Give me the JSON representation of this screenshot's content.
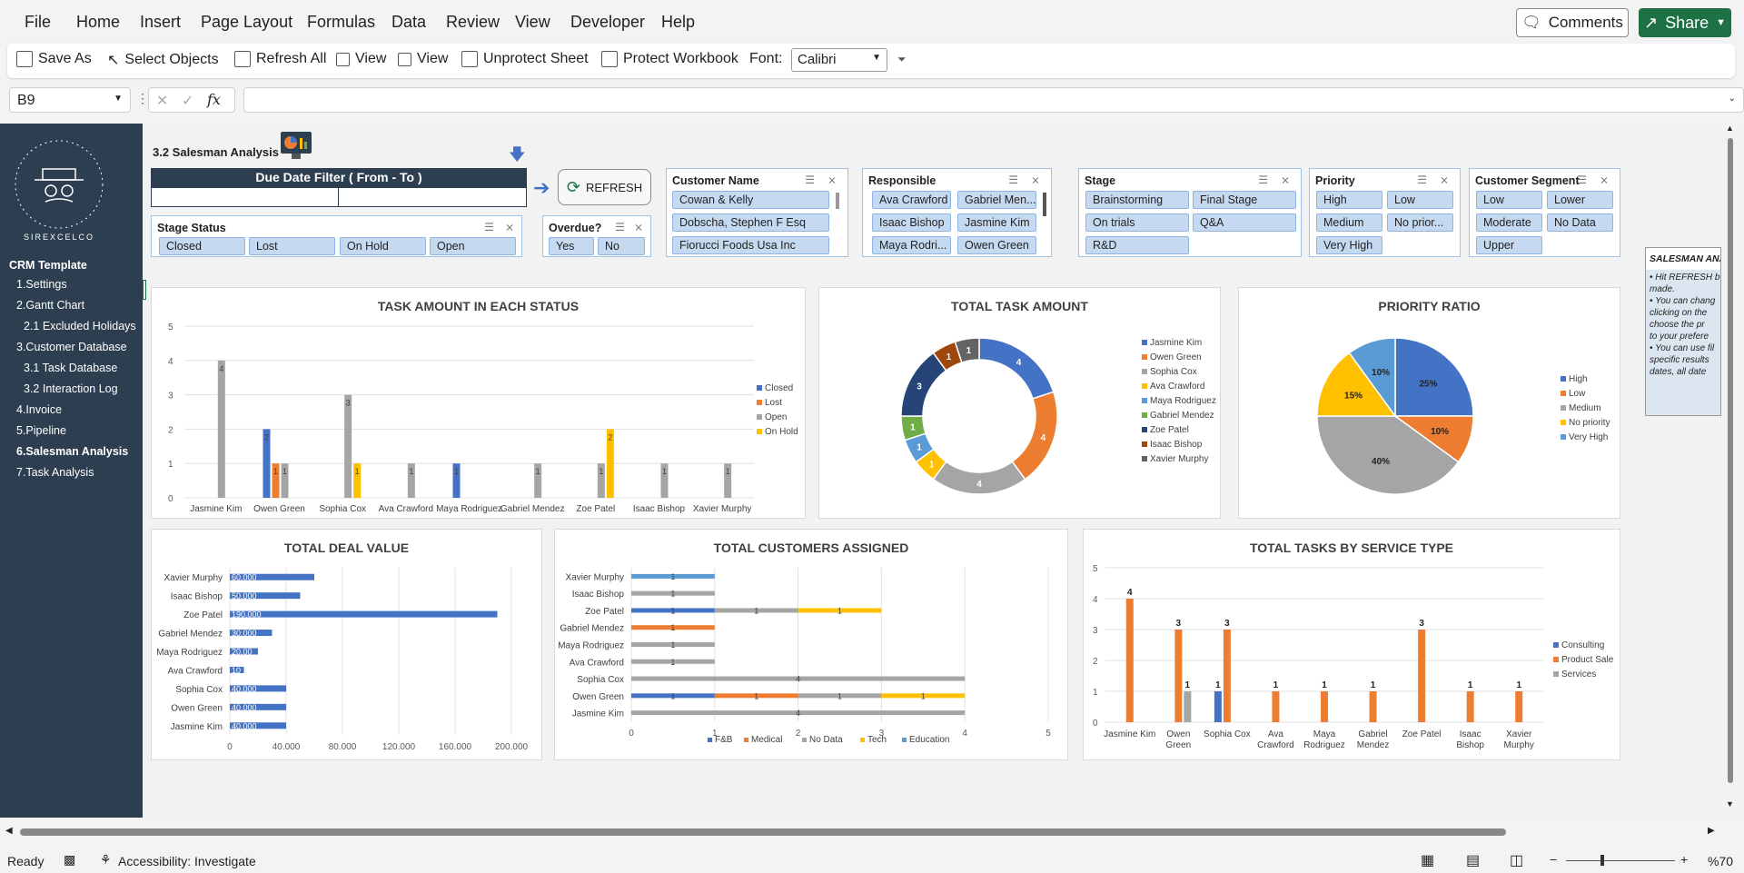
{
  "menu": {
    "items": [
      "File",
      "Home",
      "Insert",
      "Page Layout",
      "Formulas",
      "Data",
      "Review",
      "View",
      "Developer",
      "Help"
    ],
    "comments": "Comments",
    "share": "Share"
  },
  "ribbon": {
    "save_as": "Save As",
    "select_objects": "Select Objects",
    "refresh_all": "Refresh All",
    "view1": "View",
    "view2": "View",
    "unprotect_sheet": "Unprotect Sheet",
    "protect_workbook": "Protect Workbook",
    "font_label": "Font:",
    "font_value": "Calibri"
  },
  "formula": {
    "cell_ref": "B9",
    "fx": "fx"
  },
  "sidebar": {
    "header": "CRM Template",
    "logo_text": "SIREXCELCO",
    "items": [
      "1.Settings",
      "2.Gantt Chart",
      "2.1 Excluded Holidays",
      "3.Customer Database",
      "3.1 Task Database",
      "3.2 Interaction Log",
      "4.Invoice",
      "5.Pipeline",
      "6.Salesman Analysis",
      "7.Task Analysis"
    ]
  },
  "header": {
    "title": "3.2 Salesman Analysis",
    "due_date_filter": "Due Date Filter ( From - To )",
    "refresh": "REFRESH"
  },
  "slicers": {
    "stage_status": {
      "title": "Stage Status",
      "items": [
        "Closed",
        "Lost",
        "On Hold",
        "Open"
      ]
    },
    "overdue": {
      "title": "Overdue?",
      "items": [
        "Yes",
        "No"
      ]
    },
    "customer_name": {
      "title": "Customer Name",
      "items": [
        "Cowan & Kelly",
        "Dobscha, Stephen F Esq",
        "Fiorucci Foods Usa Inc"
      ]
    },
    "responsible": {
      "title": "Responsible",
      "items": [
        "Ava Crawford",
        "Gabriel Men...",
        "Isaac Bishop",
        "Jasmine Kim",
        "Maya Rodri...",
        "Owen Green"
      ]
    },
    "stage": {
      "title": "Stage",
      "items": [
        "Brainstorming",
        "Final Stage",
        "On trials",
        "Q&A",
        "R&D"
      ]
    },
    "priority": {
      "title": "Priority",
      "items": [
        "High",
        "Low",
        "Medium",
        "No prior...",
        "Very High"
      ]
    },
    "segment": {
      "title": "Customer Segment",
      "items": [
        "Low",
        "Lower",
        "Moderate",
        "No Data",
        "Upper"
      ]
    }
  },
  "notes": {
    "title": "SALESMAN ANA",
    "lines": [
      "Hit REFRESH b",
      "made.",
      "You can chang",
      "clicking on the",
      "choose the pr",
      "to your prefere",
      "You can use fil",
      "specific results",
      "dates, all date"
    ]
  },
  "colors": {
    "blue": "#4472c4",
    "orange": "#ed7d31",
    "gray": "#a5a5a5",
    "yellow": "#ffc000",
    "lightblue": "#5b9bd5",
    "green": "#70ad47",
    "navy": "#264478",
    "brown": "#9e480e",
    "darkgray": "#636363",
    "sidebar": "#2c3e50"
  },
  "chart_data": [
    {
      "id": "task_status",
      "type": "bar",
      "title": "TASK AMOUNT IN EACH STATUS",
      "categories": [
        "Jasmine Kim",
        "Owen Green",
        "Sophia Cox",
        "Ava Crawford",
        "Maya Rodriguez",
        "Gabriel Mendez",
        "Zoe Patel",
        "Isaac Bishop",
        "Xavier Murphy"
      ],
      "series": [
        {
          "name": "Closed",
          "values": [
            0,
            2,
            0,
            0,
            1,
            0,
            0,
            0,
            0
          ]
        },
        {
          "name": "Lost",
          "values": [
            0,
            1,
            0,
            0,
            0,
            0,
            0,
            0,
            0
          ]
        },
        {
          "name": "Open",
          "values": [
            4,
            1,
            3,
            1,
            0,
            1,
            1,
            1,
            1
          ]
        },
        {
          "name": "On Hold",
          "values": [
            0,
            0,
            1,
            0,
            0,
            0,
            2,
            0,
            0
          ]
        }
      ],
      "ylim": [
        0,
        5
      ],
      "yticks": [
        0,
        1,
        2,
        3,
        4,
        5
      ],
      "legend": "right"
    },
    {
      "id": "total_task",
      "type": "pie",
      "title": "TOTAL TASK AMOUNT",
      "donut": true,
      "labels": [
        "Jasmine Kim",
        "Owen Green",
        "Sophia Cox",
        "Ava Crawford",
        "Maya Rodriguez",
        "Gabriel Mendez",
        "Zoe Patel",
        "Isaac Bishop",
        "Xavier Murphy"
      ],
      "values": [
        4,
        4,
        4,
        1,
        1,
        1,
        3,
        1,
        1
      ],
      "legend": "right"
    },
    {
      "id": "priority_ratio",
      "type": "pie",
      "title": "PRIORITY RATIO",
      "labels": [
        "High",
        "Low",
        "Medium",
        "No priority",
        "Very High"
      ],
      "values": [
        25,
        10,
        40,
        15,
        10
      ],
      "value_labels": [
        "25%",
        "10%",
        "40%",
        "15%",
        "10%"
      ],
      "legend": "right"
    },
    {
      "id": "deal_value",
      "type": "bar",
      "orientation": "horizontal",
      "title": "TOTAL DEAL VALUE",
      "categories": [
        "Xavier Murphy",
        "Isaac Bishop",
        "Zoe Patel",
        "Gabriel Mendez",
        "Maya Rodriguez",
        "Ava Crawford",
        "Sophia Cox",
        "Owen Green",
        "Jasmine Kim"
      ],
      "values": [
        60000,
        50000,
        190000,
        30000,
        20000,
        10000,
        40000,
        40000,
        40000
      ],
      "value_labels": [
        "60.000",
        "50.000",
        "190.000",
        "30.000",
        "20.00",
        "10",
        "40.000",
        "40.000",
        "40.000"
      ],
      "xlim": [
        0,
        200000
      ],
      "xticks": [
        "0",
        "40.000",
        "80.000",
        "120.000",
        "160.000",
        "200.000"
      ]
    },
    {
      "id": "customers_assigned",
      "type": "bar",
      "orientation": "horizontal",
      "stacked": true,
      "title": "TOTAL CUSTOMERS ASSIGNED",
      "categories": [
        "Xavier Murphy",
        "Isaac Bishop",
        "Zoe Patel",
        "Gabriel Mendez",
        "Maya Rodriguez",
        "Ava Crawford",
        "Sophia Cox",
        "Owen Green",
        "Jasmine Kim"
      ],
      "series": [
        {
          "name": "F&B",
          "values": [
            0,
            0,
            1,
            0,
            0,
            0,
            0,
            1,
            0
          ]
        },
        {
          "name": "Medical",
          "values": [
            0,
            0,
            0,
            1,
            0,
            0,
            0,
            1,
            0
          ]
        },
        {
          "name": "No Data",
          "values": [
            0,
            1,
            1,
            0,
            1,
            1,
            4,
            1,
            4
          ]
        },
        {
          "name": "Tech",
          "values": [
            0,
            0,
            1,
            0,
            0,
            0,
            0,
            1,
            0
          ]
        },
        {
          "name": "Education",
          "values": [
            1,
            0,
            0,
            0,
            0,
            0,
            0,
            0,
            0
          ]
        }
      ],
      "xlim": [
        0,
        5
      ],
      "xticks": [
        0,
        1,
        2,
        3,
        4,
        5
      ],
      "legend": "bottom"
    },
    {
      "id": "service_type",
      "type": "bar",
      "title": "TOTAL TASKS BY SERVICE TYPE",
      "categories": [
        "Jasmine Kim",
        "Owen Green",
        "Sophia Cox",
        "Ava Crawford",
        "Maya Rodriguez",
        "Gabriel Mendez",
        "Zoe Patel",
        "Isaac Bishop",
        "Xavier Murphy"
      ],
      "series": [
        {
          "name": "Consulting",
          "values": [
            0,
            0,
            1,
            0,
            0,
            0,
            0,
            0,
            0
          ]
        },
        {
          "name": "Product Sale",
          "values": [
            4,
            3,
            3,
            1,
            1,
            1,
            3,
            1,
            1
          ]
        },
        {
          "name": "Services",
          "values": [
            0,
            1,
            0,
            0,
            0,
            0,
            0,
            0,
            0
          ]
        }
      ],
      "ylim": [
        0,
        5
      ],
      "yticks": [
        0,
        1,
        2,
        3,
        4,
        5
      ],
      "legend": "right"
    }
  ],
  "status": {
    "ready": "Ready",
    "accessibility": "Accessibility: Investigate",
    "zoom": "%70"
  }
}
